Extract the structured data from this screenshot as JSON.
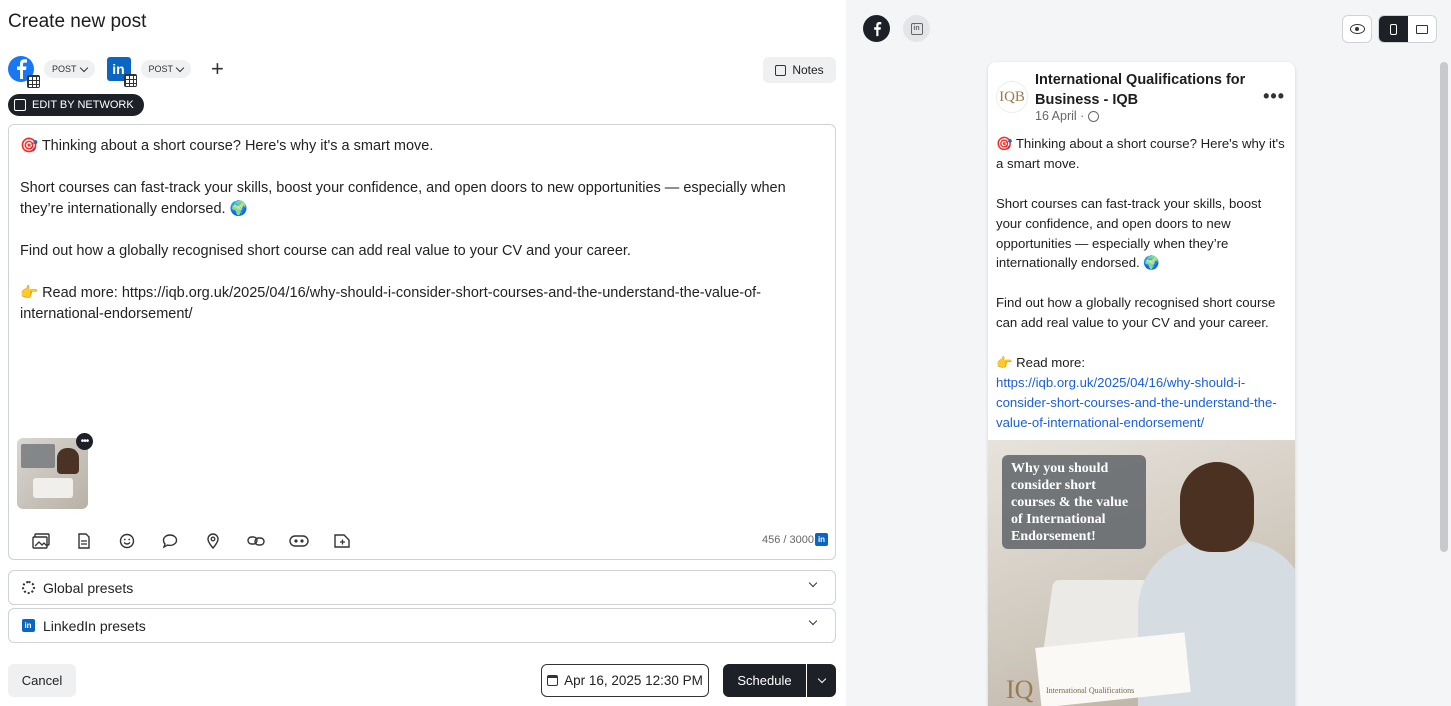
{
  "page_title": "Create new post",
  "networks": [
    {
      "name": "facebook",
      "type_label": "POST"
    },
    {
      "name": "linkedin",
      "type_label": "POST"
    }
  ],
  "notes_label": "Notes",
  "edit_by_network_label": "EDIT BY NETWORK",
  "editor": {
    "text": "🎯 Thinking about a short course? Here's why it's a smart move.\n\nShort courses can fast-track your skills, boost your confidence, and open doors to new opportunities — especially when they’re internationally endorsed. 🌍\n\nFind out how a globally recognised short course can add real value to your CV and your career.\n\n👉 Read more: https://iqb.org.uk/2025/04/16/why-should-i-consider-short-courses-and-the-understand-the-value-of-international-endorsement/",
    "char_count": "456 / 3000"
  },
  "presets": {
    "global_label": "Global presets",
    "linkedin_label": "LinkedIn presets"
  },
  "footer": {
    "cancel_label": "Cancel",
    "datetime": "Apr 16, 2025 12:30 PM",
    "schedule_label": "Schedule"
  },
  "preview": {
    "account_name": "International Qualifications for Business - IQB",
    "avatar_text": "IQB",
    "date": "16 April ·",
    "body_text": "🎯 Thinking about a short course? Here's why it's a smart move.\n\nShort courses can fast-track your skills, boost your confidence, and open doors to new opportunities — especially when they’re internationally endorsed. 🌍\n\nFind out how a globally recognised short course can add real value to your CV and your career.\n\n👉 Read more:\n",
    "link": "https://iqb.org.uk/2025/04/16/why-should-i-consider-short-courses-and-the-understand-the-value-of-international-endorsement/",
    "image_caption": "Why you should consider short courses & the value of International Endorsement!",
    "image_logo_text": "International Qualifications"
  },
  "colors": {
    "accent_dark": "#1d2127",
    "facebook": "#1877f2",
    "linkedin": "#0a66c2",
    "link": "#1a5fd8"
  }
}
